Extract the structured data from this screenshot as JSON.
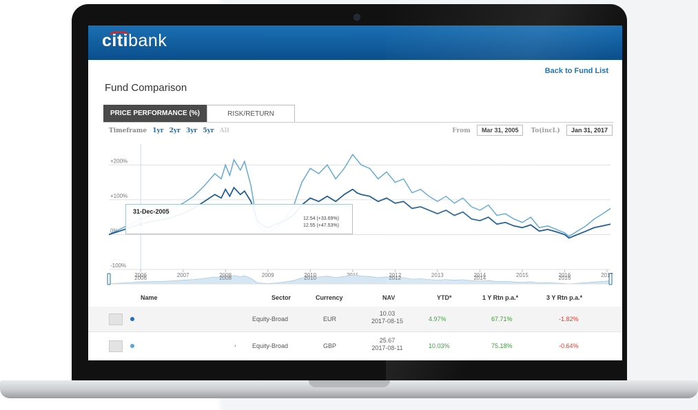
{
  "brand": {
    "logo_citi": "citi",
    "logo_bank": "bank"
  },
  "nav": {
    "back_link": "Back to Fund List"
  },
  "page": {
    "title": "Fund Comparison"
  },
  "tabs": [
    {
      "label": "PRICE PERFORMANCE (%)",
      "active": true
    },
    {
      "label": "RISK/RETURN",
      "active": false
    }
  ],
  "timeframe": {
    "label": "Timeframe",
    "options": [
      "1yr",
      "2yr",
      "3yr",
      "5yr",
      "All"
    ],
    "disabled_option": "All"
  },
  "date_range": {
    "from_label": "From",
    "from_value": "Mar 31, 2005",
    "to_label": "To(incl.)",
    "to_value": "Jan 31, 2017"
  },
  "tooltip": {
    "date": "31-Dec-2005",
    "value1": "12.54 (+33.69%)",
    "value2": "12.55 (+47.53%)"
  },
  "chart_data": {
    "type": "line",
    "y_ticks": [
      "+200%",
      "+100%",
      "0%",
      "-100%"
    ],
    "ylim": [
      -100,
      260
    ],
    "x_ticks": [
      "2006",
      "2007",
      "2008",
      "2009",
      "2010",
      "2011",
      "2012",
      "2013",
      "2014",
      "2015",
      "2016",
      "2017"
    ],
    "navigator_ticks": [
      "2006",
      "2008",
      "2010",
      "2012",
      "2014",
      "2016"
    ],
    "x_range": [
      2005.25,
      2017.08
    ],
    "series": [
      {
        "color": "#5aa6d6",
        "x": [
          2005.25,
          2005.5,
          2005.75,
          2006.0,
          2006.25,
          2006.5,
          2006.75,
          2007.0,
          2007.25,
          2007.5,
          2007.75,
          2007.9,
          2008.0,
          2008.1,
          2008.2,
          2008.35,
          2008.45,
          2008.6,
          2008.75,
          2008.9,
          2009.0,
          2009.2,
          2009.4,
          2009.6,
          2009.8,
          2010.0,
          2010.2,
          2010.4,
          2010.6,
          2010.8,
          2011.0,
          2011.1,
          2011.2,
          2011.4,
          2011.6,
          2011.8,
          2012.0,
          2012.2,
          2012.4,
          2012.6,
          2012.8,
          2013.0,
          2013.2,
          2013.4,
          2013.6,
          2013.8,
          2014.0,
          2014.2,
          2014.4,
          2014.6,
          2014.8,
          2015.0,
          2015.2,
          2015.4,
          2015.6,
          2015.8,
          2016.0,
          2016.1,
          2016.3,
          2016.5,
          2016.7,
          2016.9,
          2017.08
        ],
        "y": [
          0,
          15,
          30,
          45,
          55,
          60,
          75,
          90,
          110,
          140,
          175,
          160,
          200,
          170,
          215,
          185,
          210,
          140,
          30,
          10,
          5,
          20,
          45,
          80,
          150,
          190,
          175,
          200,
          160,
          190,
          230,
          215,
          200,
          190,
          160,
          180,
          150,
          160,
          120,
          130,
          110,
          95,
          110,
          90,
          105,
          80,
          70,
          85,
          55,
          60,
          45,
          35,
          50,
          20,
          25,
          15,
          5,
          -5,
          10,
          25,
          45,
          60,
          75
        ]
      },
      {
        "color": "#1f5f96",
        "x": [
          2005.25,
          2005.5,
          2005.75,
          2006.0,
          2006.25,
          2006.5,
          2006.75,
          2007.0,
          2007.25,
          2007.5,
          2007.75,
          2007.9,
          2008.0,
          2008.1,
          2008.2,
          2008.35,
          2008.45,
          2008.6,
          2008.75,
          2008.9,
          2009.0,
          2009.2,
          2009.4,
          2009.6,
          2009.8,
          2010.0,
          2010.2,
          2010.4,
          2010.6,
          2010.8,
          2011.0,
          2011.1,
          2011.2,
          2011.4,
          2011.6,
          2011.8,
          2012.0,
          2012.2,
          2012.4,
          2012.6,
          2012.8,
          2013.0,
          2013.2,
          2013.4,
          2013.6,
          2013.8,
          2014.0,
          2014.2,
          2014.4,
          2014.6,
          2014.8,
          2015.0,
          2015.2,
          2015.4,
          2015.6,
          2015.8,
          2016.0,
          2016.1,
          2016.3,
          2016.5,
          2016.7,
          2016.9,
          2017.08
        ],
        "y": [
          0,
          10,
          20,
          30,
          38,
          42,
          50,
          60,
          75,
          95,
          115,
          105,
          130,
          110,
          135,
          115,
          125,
          95,
          40,
          25,
          20,
          30,
          40,
          55,
          85,
          105,
          95,
          110,
          95,
          115,
          130,
          120,
          115,
          110,
          95,
          105,
          90,
          95,
          75,
          80,
          70,
          60,
          70,
          55,
          65,
          45,
          40,
          50,
          30,
          35,
          25,
          20,
          28,
          10,
          15,
          8,
          0,
          -10,
          0,
          10,
          20,
          25,
          30
        ]
      }
    ]
  },
  "table": {
    "headers": {
      "name": "Name",
      "sector": "Sector",
      "currency": "Currency",
      "nav": "NAV",
      "ytd": "YTD*",
      "r1y": "1 Y Rtn p.a.*",
      "r3y": "3 Y Rtn p.a.*"
    },
    "rows": [
      {
        "dot_color": "#1f6fc0",
        "sector": "Equity-Broad",
        "currency": "EUR",
        "nav": "10.03",
        "nav_date": "2017-08-15",
        "ytd": "4.97%",
        "r1y": "67.71%",
        "r3y": "-1.82%"
      },
      {
        "dot_color": "#5aa6d6",
        "arrow": "›",
        "sector": "Equity-Broad",
        "currency": "GBP",
        "nav": "25.67",
        "nav_date": "2017-08-11",
        "ytd": "10.03%",
        "r1y": "75.18%",
        "r3y": "-0.64%"
      }
    ]
  }
}
